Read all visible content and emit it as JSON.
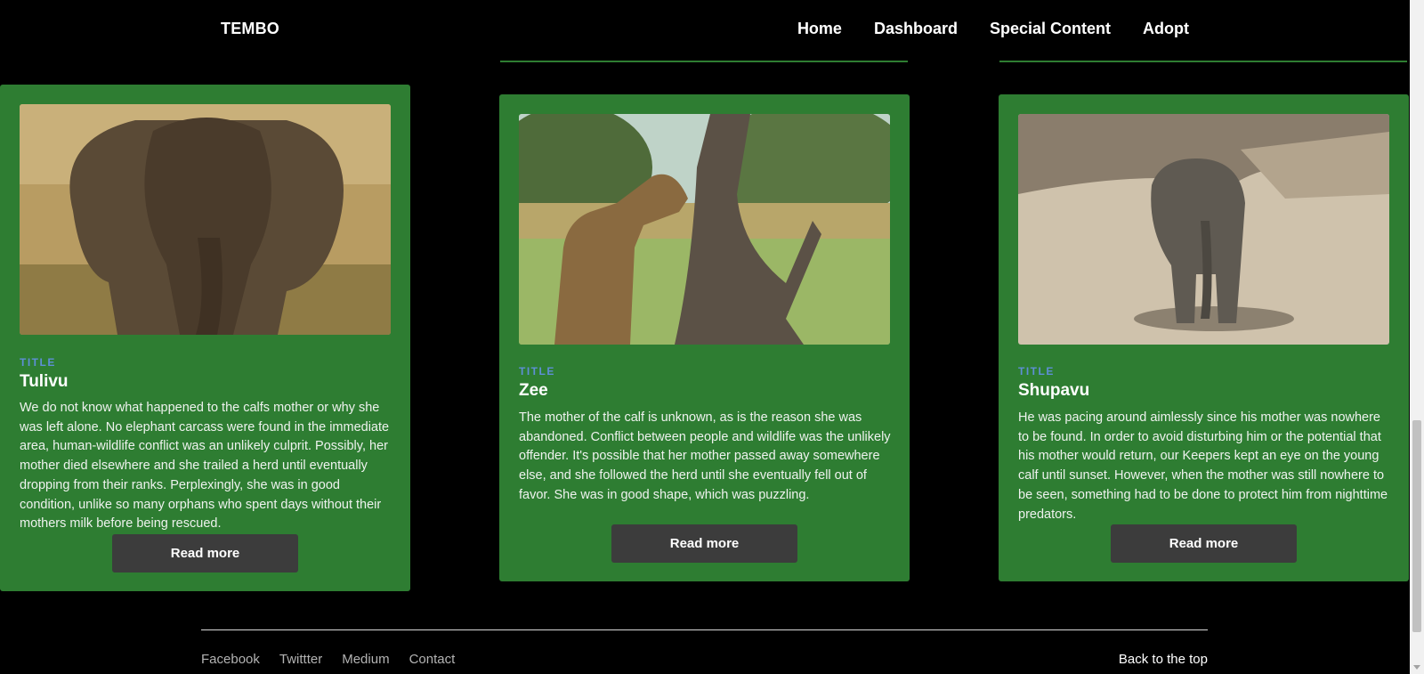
{
  "header": {
    "brand": "TEMBO",
    "nav": [
      "Home",
      "Dashboard",
      "Special Content",
      "Adopt"
    ]
  },
  "cards": [
    {
      "eyebrow": "TITLE",
      "title": "Tulivu",
      "body": "We do not know what happened to the calfs mother or why she was left alone. No elephant carcass were found in the immediate area, human-wildlife conflict was an unlikely culprit. Possibly, her mother died elsewhere and she trailed a herd until eventually dropping from their ranks. Perplexingly, she was in good condition, unlike so many orphans who spent days without their mothers milk before being rescued.",
      "button": "Read more",
      "image": "elephant-adult-photo"
    },
    {
      "eyebrow": "TITLE",
      "title": "Zee",
      "body": "The mother of the calf is unknown, as is the reason she was abandoned. Conflict between people and wildlife was the unlikely offender. It's possible that her mother passed away somewhere else, and she followed the herd until she eventually fell out of favor. She was in good shape, which was puzzling.",
      "button": "Read more",
      "image": "giraffe-photo"
    },
    {
      "eyebrow": "TITLE",
      "title": "Shupavu",
      "body": "He was pacing around aimlessly since his mother was nowhere to be found. In order to avoid disturbing him or the potential that his mother would return, our Keepers kept an eye on the young calf until sunset. However, when the mother was still nowhere to be seen, something had to be done to protect him from nighttime predators.",
      "button": "Read more",
      "image": "elephant-calf-photo"
    }
  ],
  "footer": {
    "links": [
      "Facebook",
      "Twittter",
      "Medium",
      "Contact"
    ],
    "back_to_top": "Back to the top"
  },
  "colors": {
    "card": "#2e7d32",
    "button": "#3c3c3c",
    "eyebrow": "#5e8fd6",
    "background": "#000000"
  }
}
